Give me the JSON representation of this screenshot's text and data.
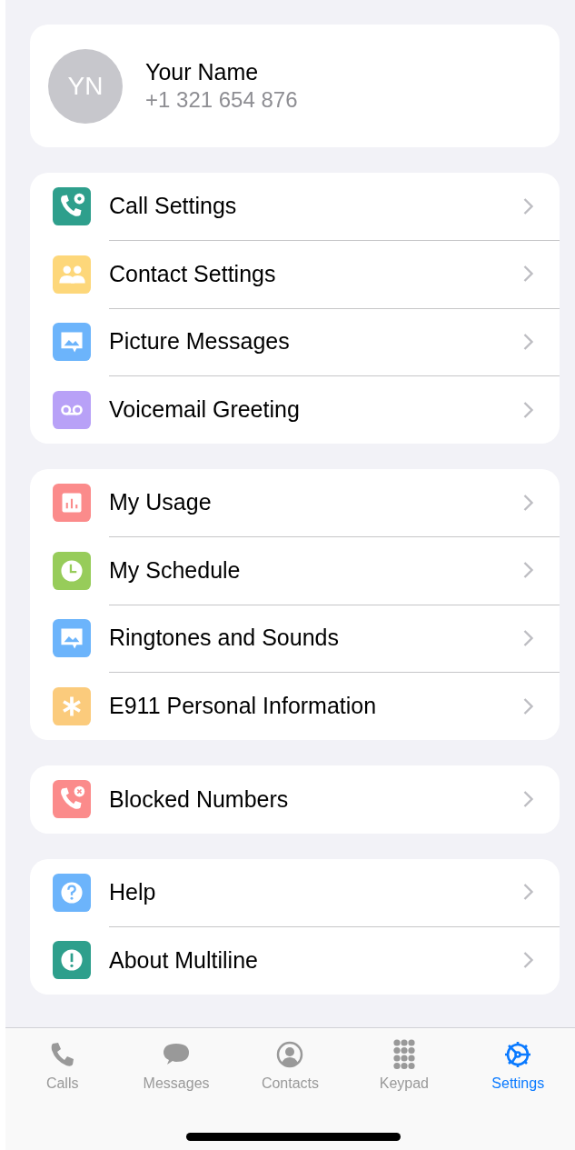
{
  "profile": {
    "initials": "YN",
    "name": "Your Name",
    "phone": "+1 321 654 876"
  },
  "sections": [
    {
      "items": [
        {
          "label": "Call Settings",
          "color": "#2e9f8c"
        },
        {
          "label": "Contact Settings",
          "color": "#fdd77a"
        },
        {
          "label": "Picture Messages",
          "color": "#6cb4fb"
        },
        {
          "label": "Voicemail Greeting",
          "color": "#b8a1f7"
        }
      ]
    },
    {
      "items": [
        {
          "label": "My Usage",
          "color": "#fb8b8b"
        },
        {
          "label": "My Schedule",
          "color": "#97cc5a"
        },
        {
          "label": "Ringtones and Sounds",
          "color": "#6cb4fb"
        },
        {
          "label": "E911 Personal Information",
          "color": "#fbcb7c"
        }
      ]
    },
    {
      "items": [
        {
          "label": "Blocked Numbers",
          "color": "#fb8b8b"
        }
      ]
    },
    {
      "items": [
        {
          "label": "Help",
          "color": "#6cb4fb"
        },
        {
          "label": "About Multiline",
          "color": "#2e9f8c"
        }
      ]
    }
  ],
  "tabs": [
    {
      "label": "Calls",
      "selected": false
    },
    {
      "label": "Messages",
      "selected": false
    },
    {
      "label": "Contacts",
      "selected": false
    },
    {
      "label": "Keypad",
      "selected": false
    },
    {
      "label": "Settings",
      "selected": true
    }
  ]
}
